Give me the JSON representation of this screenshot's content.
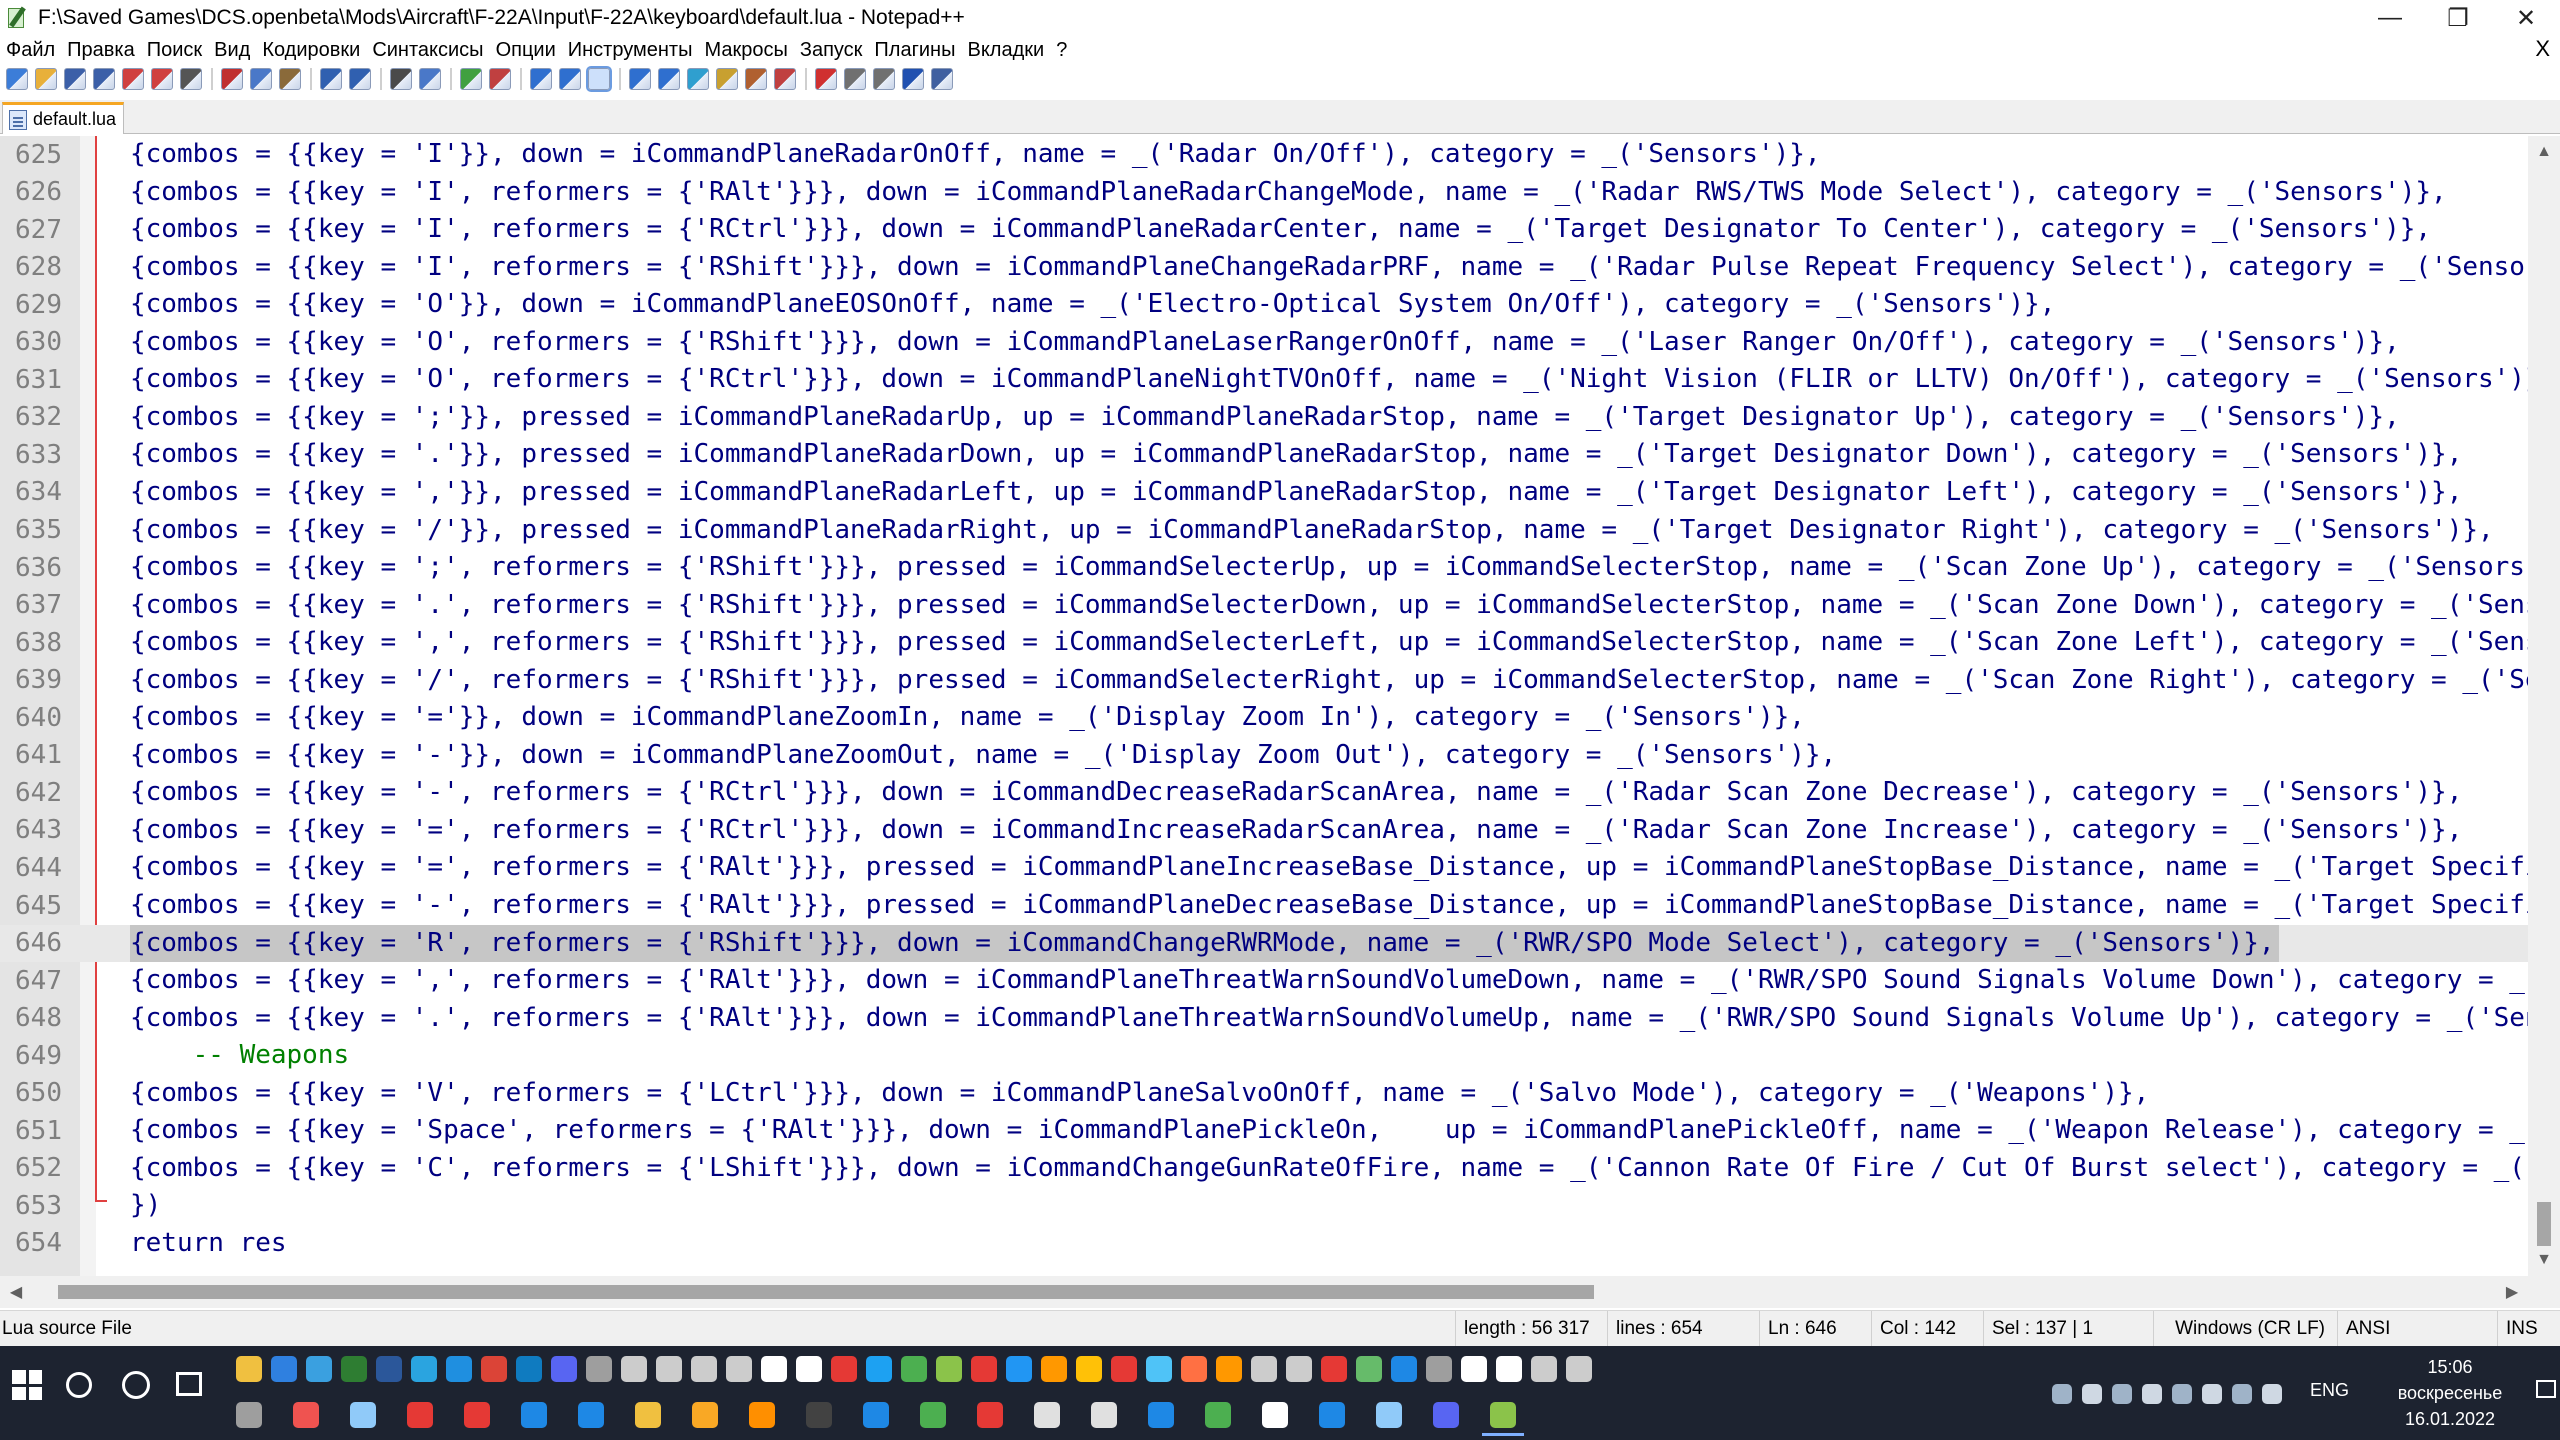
{
  "window": {
    "title": "F:\\Saved Games\\DCS.openbeta\\Mods\\Aircraft\\F-22A\\Input\\F-22A\\keyboard\\default.lua - Notepad++",
    "minimize": "—",
    "maximize": "❐",
    "close": "✕"
  },
  "menu": {
    "items": [
      "Файл",
      "Правка",
      "Поиск",
      "Вид",
      "Кодировки",
      "Синтаксисы",
      "Опции",
      "Инструменты",
      "Макросы",
      "Запуск",
      "Плагины",
      "Вкладки",
      "?"
    ],
    "close_doc": "X"
  },
  "toolbar": {
    "icons": [
      "new-file-icon",
      "open-file-icon",
      "save-icon",
      "save-all-icon",
      "close-icon",
      "close-all-icon",
      "print-icon",
      "cut-icon",
      "copy-icon",
      "paste-icon",
      "undo-icon",
      "redo-icon",
      "find-icon",
      "replace-icon",
      "zoom-in-icon",
      "zoom-out-icon",
      "sync-vertical-icon",
      "sync-horizontal-icon",
      "word-wrap-icon",
      "show-all-chars-icon",
      "indent-guide-icon",
      "doc-map-icon",
      "function-list-icon",
      "folder-workspace-icon",
      "monitoring-icon",
      "record-macro-icon",
      "stop-record-icon",
      "play-macro-icon",
      "run-macro-multiple-icon",
      "save-macro-icon"
    ],
    "colors": [
      "#3c7dd8",
      "#e8b03a",
      "#3b5fa8",
      "#3b5fa8",
      "#d04040",
      "#d04040",
      "#555555",
      "#c03030",
      "#4a78c8",
      "#8a6a3a",
      "#3060b0",
      "#3060b0",
      "#4a4a4a",
      "#4a78c8",
      "#40a040",
      "#c04040",
      "#2f6fcf",
      "#2f6fcf",
      "#2f6fcf",
      "#2f6fcf",
      "#2f6fcf",
      "#2f9fcf",
      "#c8a030",
      "#b06030",
      "#c04040",
      "#d03030",
      "#707070",
      "#707070",
      "#2050b0",
      "#4060a0"
    ]
  },
  "tab": {
    "label": "default.lua"
  },
  "editor": {
    "lines": [
      {
        "num": "625",
        "text": "{combos = {{key = 'I'}}, down = iCommandPlaneRadarOnOff, name = _('Radar On/Off'), category = _('Sensors')},"
      },
      {
        "num": "626",
        "text": "{combos = {{key = 'I', reformers = {'RAlt'}}}, down = iCommandPlaneRadarChangeMode, name = _('Radar RWS/TWS Mode Select'), category = _('Sensors')},"
      },
      {
        "num": "627",
        "text": "{combos = {{key = 'I', reformers = {'RCtrl'}}}, down = iCommandPlaneRadarCenter, name = _('Target Designator To Center'), category = _('Sensors')},"
      },
      {
        "num": "628",
        "text": "{combos = {{key = 'I', reformers = {'RShift'}}}, down = iCommandPlaneChangeRadarPRF, name = _('Radar Pulse Repeat Frequency Select'), category = _('Sensors')},"
      },
      {
        "num": "629",
        "text": "{combos = {{key = 'O'}}, down = iCommandPlaneEOSOnOff, name = _('Electro-Optical System On/Off'), category = _('Sensors')},"
      },
      {
        "num": "630",
        "text": "{combos = {{key = 'O', reformers = {'RShift'}}}, down = iCommandPlaneLaserRangerOnOff, name = _('Laser Ranger On/Off'), category = _('Sensors')},"
      },
      {
        "num": "631",
        "text": "{combos = {{key = 'O', reformers = {'RCtrl'}}}, down = iCommandPlaneNightTVOnOff, name = _('Night Vision (FLIR or LLTV) On/Off'), category = _('Sensors')},"
      },
      {
        "num": "632",
        "text": "{combos = {{key = ';'}}, pressed = iCommandPlaneRadarUp, up = iCommandPlaneRadarStop, name = _('Target Designator Up'), category = _('Sensors')},"
      },
      {
        "num": "633",
        "text": "{combos = {{key = '.'}}, pressed = iCommandPlaneRadarDown, up = iCommandPlaneRadarStop, name = _('Target Designator Down'), category = _('Sensors')},"
      },
      {
        "num": "634",
        "text": "{combos = {{key = ','}}, pressed = iCommandPlaneRadarLeft, up = iCommandPlaneRadarStop, name = _('Target Designator Left'), category = _('Sensors')},"
      },
      {
        "num": "635",
        "text": "{combos = {{key = '/'}}, pressed = iCommandPlaneRadarRight, up = iCommandPlaneRadarStop, name = _('Target Designator Right'), category = _('Sensors')},"
      },
      {
        "num": "636",
        "text": "{combos = {{key = ';', reformers = {'RShift'}}}, pressed = iCommandSelecterUp, up = iCommandSelecterStop, name = _('Scan Zone Up'), category = _('Sensors')},"
      },
      {
        "num": "637",
        "text": "{combos = {{key = '.', reformers = {'RShift'}}}, pressed = iCommandSelecterDown, up = iCommandSelecterStop, name = _('Scan Zone Down'), category = _('Sensors')},"
      },
      {
        "num": "638",
        "text": "{combos = {{key = ',', reformers = {'RShift'}}}, pressed = iCommandSelecterLeft, up = iCommandSelecterStop, name = _('Scan Zone Left'), category = _('Sensors')},"
      },
      {
        "num": "639",
        "text": "{combos = {{key = '/', reformers = {'RShift'}}}, pressed = iCommandSelecterRight, up = iCommandSelecterStop, name = _('Scan Zone Right'), category = _('Sensors')},"
      },
      {
        "num": "640",
        "text": "{combos = {{key = '='}}, down = iCommandPlaneZoomIn, name = _('Display Zoom In'), category = _('Sensors')},"
      },
      {
        "num": "641",
        "text": "{combos = {{key = '-'}}, down = iCommandPlaneZoomOut, name = _('Display Zoom Out'), category = _('Sensors')},"
      },
      {
        "num": "642",
        "text": "{combos = {{key = '-', reformers = {'RCtrl'}}}, down = iCommandDecreaseRadarScanArea, name = _('Radar Scan Zone Decrease'), category = _('Sensors')},"
      },
      {
        "num": "643",
        "text": "{combos = {{key = '=', reformers = {'RCtrl'}}}, down = iCommandIncreaseRadarScanArea, name = _('Radar Scan Zone Increase'), category = _('Sensors')},"
      },
      {
        "num": "644",
        "text": "{combos = {{key = '=', reformers = {'RAlt'}}}, pressed = iCommandPlaneIncreaseBase_Distance, up = iCommandPlaneStopBase_Distance, name = _('Target Specified Size Increase'), category = _('Sensors')},"
      },
      {
        "num": "645",
        "text": "{combos = {{key = '-', reformers = {'RAlt'}}}, pressed = iCommandPlaneDecreaseBase_Distance, up = iCommandPlaneStopBase_Distance, name = _('Target Specified Size Decrease'), category = _('Sensors')},"
      },
      {
        "num": "646",
        "text": "{combos = {{key = 'R', reformers = {'RShift'}}}, down = iCommandChangeRWRMode, name = _('RWR/SPO Mode Select'), category = _('Sensors')},",
        "current": true
      },
      {
        "num": "647",
        "text": "{combos = {{key = ',', reformers = {'RAlt'}}}, down = iCommandPlaneThreatWarnSoundVolumeDown, name = _('RWR/SPO Sound Signals Volume Down'), category = _('Sensors')},"
      },
      {
        "num": "648",
        "text": "{combos = {{key = '.', reformers = {'RAlt'}}}, down = iCommandPlaneThreatWarnSoundVolumeUp, name = _('RWR/SPO Sound Signals Volume Up'), category = _('Sensors')},"
      },
      {
        "num": "649",
        "text": "    -- Weapons",
        "comment": true
      },
      {
        "num": "650",
        "text": "{combos = {{key = 'V', reformers = {'LCtrl'}}}, down = iCommandPlaneSalvoOnOff, name = _('Salvo Mode'), category = _('Weapons')},"
      },
      {
        "num": "651",
        "text": "{combos = {{key = 'Space', reformers = {'RAlt'}}}, down = iCommandPlanePickleOn,    up = iCommandPlanePickleOff, name = _('Weapon Release'), category = _('Weapons')},"
      },
      {
        "num": "652",
        "text": "{combos = {{key = 'C', reformers = {'LShift'}}}, down = iCommandChangeGunRateOfFire, name = _('Cannon Rate Of Fire / Cut Of Burst select'), category = _('Weapons')},"
      },
      {
        "num": "653",
        "text": "})"
      },
      {
        "num": "654",
        "text": "return res",
        "keyword": true
      }
    ]
  },
  "scroll": {
    "up": "▲",
    "down": "▼",
    "left": "◀",
    "right": "▶"
  },
  "status": {
    "file_type": "Lua source File",
    "length": "length : 56 317",
    "lines": "lines : 654",
    "ln": "Ln : 646",
    "col": "Col : 142",
    "sel": "Sel : 137 | 1",
    "eol": "Windows (CR LF)",
    "encoding": "ANSI",
    "mode": "INS"
  },
  "taskbar": {
    "lang": "ENG",
    "time": "15:06",
    "day": "воскресенье",
    "date": "16.01.2022",
    "top_row_colors": [
      "#f0c040",
      "#2f80e0",
      "#3aa0e0",
      "#2e7d32",
      "#2b579a",
      "#2aa4e0",
      "#1f8fe0",
      "#db4437",
      "#0f7bc0",
      "#5865f2",
      "#9e9e9e",
      "#cccccc",
      "#cccccc",
      "#cccccc",
      "#cccccc",
      "#ffffff",
      "#ffffff",
      "#e53935",
      "#1da1f2",
      "#4caf50",
      "#8bc34a",
      "#e53935",
      "#2196f3",
      "#ff9800",
      "#ffc107",
      "#e53935",
      "#4fc3f7",
      "#ff7043",
      "#ff9800",
      "#cccccc",
      "#cccccc",
      "#e53935",
      "#66bb6a",
      "#1e88e5",
      "#9e9e9e",
      "#ffffff",
      "#ffffff",
      "#cccccc",
      "#cccccc"
    ],
    "bottom_row_colors": [
      "#9e9e9e",
      "#ef5350",
      "#90caf9",
      "#e53935",
      "#e53935",
      "#1e88e5",
      "#1e88e5",
      "#f0c040",
      "#f9a825",
      "#ff8f00",
      "#424242",
      "#1e88e5",
      "#4caf50",
      "#e53935",
      "#e0e0e0",
      "#e0e0e0",
      "#1e88e5",
      "#4caf50",
      "#ffffff",
      "#1e88e5",
      "#90caf9",
      "#5865f2",
      "#8bc34a"
    ]
  }
}
